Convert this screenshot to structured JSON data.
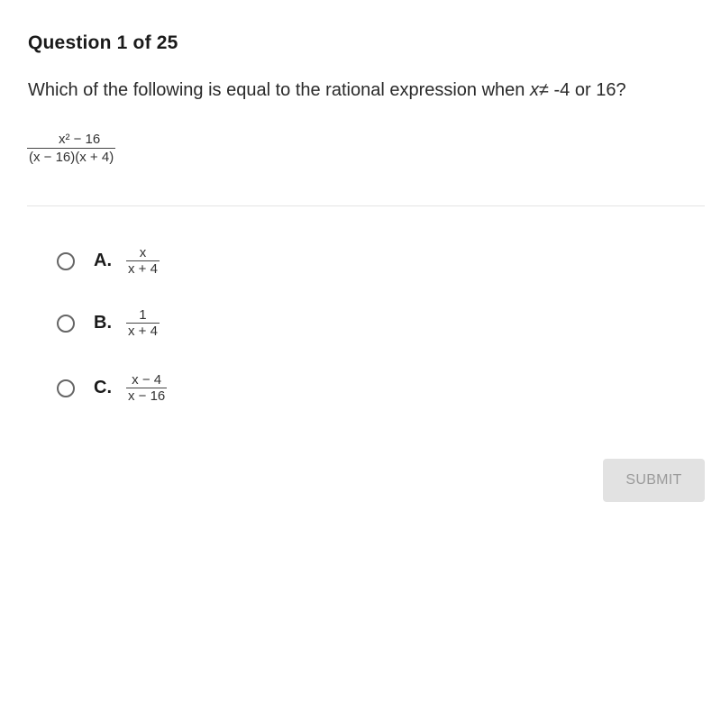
{
  "header": {
    "title": "Question 1 of 25"
  },
  "question": {
    "prompt_before": "Which of the following is equal to the rational expression when ",
    "variable": "x",
    "neq_symbol": "≠",
    "prompt_after": " -4 or 16?",
    "expression": {
      "numerator": "x² − 16",
      "denominator": "(x − 16)(x + 4)"
    }
  },
  "options": [
    {
      "letter": "A.",
      "numerator": "x",
      "denominator": "x + 4",
      "selected": false
    },
    {
      "letter": "B.",
      "numerator": "1",
      "denominator": "x + 4",
      "selected": false
    },
    {
      "letter": "C.",
      "numerator": "x − 4",
      "denominator": "x − 16",
      "selected": false
    }
  ],
  "actions": {
    "submit_label": "SUBMIT",
    "submit_enabled": false
  },
  "colors": {
    "submit_bg": "#e2e2e2",
    "submit_text": "#9a9a9a",
    "divider": "#e3e3e3"
  }
}
